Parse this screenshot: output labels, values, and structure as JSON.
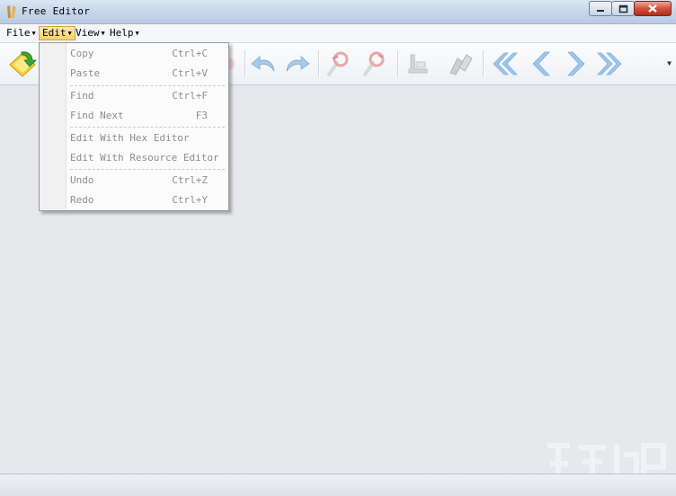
{
  "window": {
    "title": "Free Editor"
  },
  "menubar": {
    "items": [
      {
        "label": "File",
        "active": false
      },
      {
        "label": "Edit",
        "active": true
      },
      {
        "label": "View",
        "active": false
      },
      {
        "label": "Help",
        "active": false
      }
    ]
  },
  "edit_menu": {
    "copy": {
      "label": "Copy",
      "shortcut": "Ctrl+C"
    },
    "paste": {
      "label": "Paste",
      "shortcut": "Ctrl+V"
    },
    "find": {
      "label": "Find",
      "shortcut": "Ctrl+F"
    },
    "find_next": {
      "label": "Find Next",
      "shortcut": "F3"
    },
    "hex_editor": {
      "label": "Edit With Hex Editor"
    },
    "resource_editor": {
      "label": "Edit With Resource Editor"
    },
    "undo": {
      "label": "Undo",
      "shortcut": "Ctrl+Z"
    },
    "redo": {
      "label": "Redo",
      "shortcut": "Ctrl+Y"
    }
  },
  "toolbar": {
    "icons": [
      "open-folder-icon",
      "save-icon",
      "undo-icon",
      "redo-icon",
      "find-icon",
      "find-next-icon",
      "hex-editor-icon",
      "resource-editor-icon",
      "first-icon",
      "previous-icon",
      "next-icon",
      "last-icon"
    ]
  },
  "colors": {
    "menu_active": "#f8cf6b",
    "disabled_text": "#8d8d8d",
    "close_button": "#d2513c",
    "nav_arrows": "#9fc6ea"
  }
}
